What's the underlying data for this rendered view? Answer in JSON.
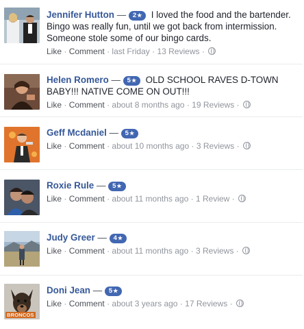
{
  "reviews": [
    {
      "name": "Jennifer Hutton",
      "dash": "—",
      "rating": "2",
      "text": "I loved the food and the bartender. Bingo was really fun, until we got back from intermission. Someone stole some of our bingo cards.",
      "like": "Like",
      "comment": "Comment",
      "time": "last Friday",
      "reviews_count": "13 Reviews",
      "avatar_icon": "wedding-photo-avatar"
    },
    {
      "name": "Helen Romero",
      "dash": "—",
      "rating": "5",
      "text": "OLD SCHOOL RAVES D-TOWN BABY!!! NATIVE COME ON OUT!!!",
      "like": "Like",
      "comment": "Comment",
      "time": "about 8 months ago",
      "reviews_count": "19 Reviews",
      "avatar_icon": "woman-portrait-avatar"
    },
    {
      "name": "Geff Mcdaniel",
      "dash": "—",
      "rating": "5",
      "text": "",
      "like": "Like",
      "comment": "Comment",
      "time": "about 10 months ago",
      "reviews_count": "3 Reviews",
      "avatar_icon": "man-orange-background-avatar"
    },
    {
      "name": "Roxie Rule",
      "dash": "—",
      "rating": "5",
      "text": "",
      "like": "Like",
      "comment": "Comment",
      "time": "about 11 months ago",
      "reviews_count": "1 Review",
      "avatar_icon": "couple-selfie-avatar"
    },
    {
      "name": "Judy Greer",
      "dash": "—",
      "rating": "4",
      "text": "",
      "like": "Like",
      "comment": "Comment",
      "time": "about 11 months ago",
      "reviews_count": "3 Reviews",
      "avatar_icon": "landscape-person-avatar"
    },
    {
      "name": "Doni Jean",
      "dash": "—",
      "rating": "5",
      "text": "",
      "like": "Like",
      "comment": "Comment",
      "time": "about 3 years ago",
      "reviews_count": "17 Reviews",
      "avatar_icon": "dog-broncos-avatar",
      "avatar_text": "BRONCOS"
    }
  ],
  "star_glyph": "★",
  "dot": "·",
  "colors": {
    "link": "#365899",
    "badge": "#4267b2",
    "meta": "#90949c"
  }
}
